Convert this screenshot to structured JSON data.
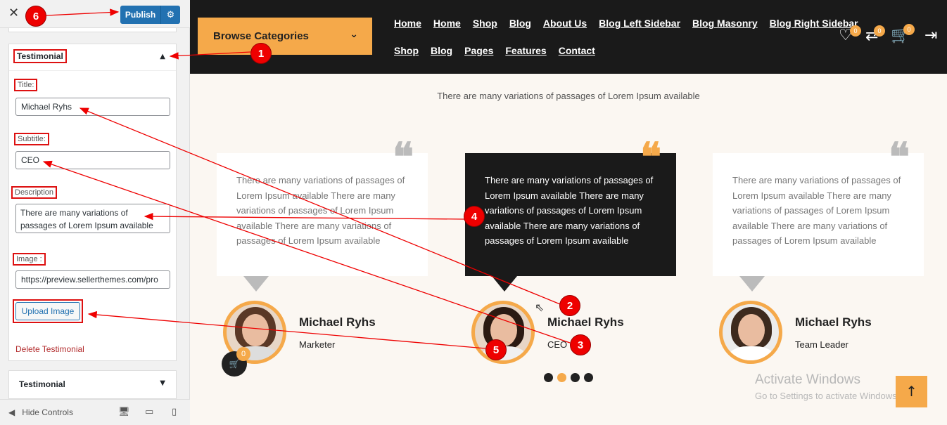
{
  "customizer": {
    "close_glyph": "✕",
    "publish_label": "Publish",
    "section_title": "Testimonial",
    "labels": {
      "title": "Title:",
      "subtitle": "Subtitle:",
      "description": "Description",
      "image": "Image :"
    },
    "values": {
      "title": "Michael Ryhs",
      "subtitle": "CEO",
      "description": "There are many variations of passages of Lorem Ipsum available",
      "image": "https://preview.sellerthemes.com/pro"
    },
    "upload_label": "Upload Image",
    "delete_label": "Delete Testimonial",
    "next_section_title": "Testimonial",
    "hide_controls": "Hide Controls"
  },
  "site": {
    "browse_label": "Browse Categories",
    "nav_row1": [
      "Home",
      "Home",
      "Shop",
      "Blog",
      "About Us",
      "Blog Left Sidebar",
      "Blog Masonry",
      "Blog Right Sidebar"
    ],
    "nav_row2": [
      "Shop",
      "Blog",
      "Pages",
      "Features",
      "Contact"
    ],
    "badges": {
      "wishlist": "0",
      "compare": "0",
      "cart": "0"
    },
    "subtitle": "There are many variations of passages of Lorem Ipsum available",
    "testimonials": [
      {
        "text": "There are many variations of passages of Lorem Ipsum available There are many variations of passages of Lorem Ipsum available There are many variations of passages of Lorem Ipsum available",
        "name": "Michael Ryhs",
        "role": "Marketer"
      },
      {
        "text": "There are many variations of passages of Lorem Ipsum available There are many variations of passages of Lorem Ipsum available There are many variations of passages of Lorem Ipsum available",
        "name": "Michael Ryhs",
        "role": "CEO"
      },
      {
        "text": "There are many variations of passages of Lorem Ipsum available There are many variations of passages of Lorem Ipsum available There are many variations of passages of Lorem Ipsum available",
        "name": "Michael Ryhs",
        "role": "Team Leader"
      }
    ],
    "float_cart_badge": "0",
    "watermark_title": "Activate Windows",
    "watermark_sub": "Go to Settings to activate Windows."
  },
  "annotations": [
    "1",
    "2",
    "3",
    "4",
    "5",
    "6"
  ],
  "colors": {
    "accent": "#f5a94a",
    "annotation": "#e00000",
    "publish": "#2271b1"
  }
}
